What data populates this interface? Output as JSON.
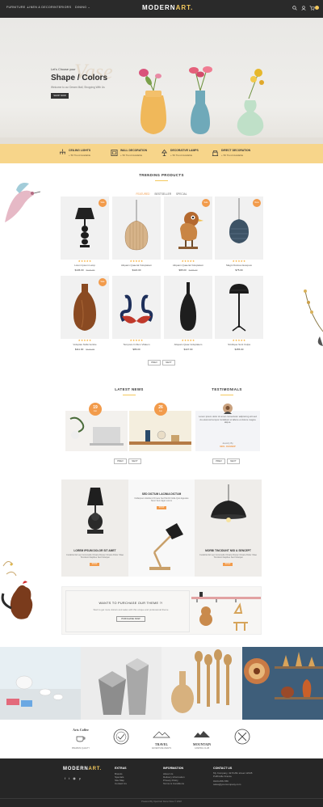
{
  "nav": {
    "menu": [
      "FURNITURE ⌄",
      "LINEN & DECOR",
      "INTERIORS",
      "DINING ⌄"
    ],
    "logo_main": "MODERN",
    "logo_accent": "ART."
  },
  "hero": {
    "script_heading": "Vase",
    "eyebrow": "Let's Choose your",
    "title": "Shape / Colors",
    "subtitle": "Welcome to our Dream Mall, Shopping With Us",
    "cta": "SHOP NOW"
  },
  "services": [
    {
      "title": "CEILING LIGHTS",
      "sub": "+ 50 Trend Available"
    },
    {
      "title": "WALL DECORATION",
      "sub": "+ 50 Trend Available"
    },
    {
      "title": "DECORATIVE LAMPS",
      "sub": "+ 50 Trend Available"
    },
    {
      "title": "DIRECT DECORATION",
      "sub": "+ 50 Trend Available"
    }
  ],
  "trending": {
    "title": "TRENDING PRODUCTS",
    "tabs": [
      "FEATURED",
      "BESTSELLER",
      "SPECIAL"
    ],
    "products": [
      {
        "name": "Lorem Ipsum Lamp",
        "price": "$136.00",
        "old": "$144.00",
        "badge": "Sale",
        "stars": "★★★★★"
      },
      {
        "name": "Aliquam Quaerat Voluptatem",
        "price": "$122.00",
        "old": "",
        "badge": "",
        "stars": "★★★★★"
      },
      {
        "name": "Aliquam Quaerat Voluptatem",
        "price": "$95.00",
        "old": "$106.00",
        "badge": "Sale",
        "stars": "★★★★★"
      },
      {
        "name": "Magni Dolores Eosquus",
        "price": "$75.00",
        "old": "",
        "badge": "New",
        "stars": "★★★★★"
      },
      {
        "name": "Voluptas Nulla Vertice",
        "price": "$111.00",
        "old": "$123.00",
        "badge": "Sale",
        "stars": "★★★★★"
      },
      {
        "name": "Tempora In Illum Vitatem",
        "price": "$86.00",
        "old": "",
        "badge": "",
        "stars": "★★★★★"
      },
      {
        "name": "Aliquam Quae Voluptatem",
        "price": "$147.00",
        "old": "",
        "badge": "",
        "stars": "★★★★★"
      },
      {
        "name": "Similique Sunt Culpa",
        "price": "$155.00",
        "old": "",
        "badge": "",
        "stars": "★★★★★"
      }
    ],
    "prev": "PREV",
    "next": "NEXT"
  },
  "news": {
    "title": "LATEST NEWS",
    "items": [
      {
        "day": "19",
        "mon": "Jun"
      },
      {
        "day": "26",
        "mon": "Jun"
      }
    ],
    "prev": "PREV",
    "next": "NEXT"
  },
  "testimonials": {
    "title": "TESTIMONIALS",
    "text": "Lorem ipsum dolor sit amet consectetur adipiscing elit sed do eiusmod tempor incididunt ut labore et dolore magna aliqua.",
    "designation": "Jewelry By",
    "name": "NIKL KEMBIP",
    "prev": "PREV",
    "next": "NEXT"
  },
  "banners": [
    {
      "title": "LOREM IPSUM DOLOR SIT AMET",
      "text": "Curabitur Et Leo Commodo Ornare Donec Ornare Dolor Vitae Tincidunt Dapibus Sed Volutpat",
      "cta": "SHOP"
    },
    {
      "title": "SED DICTUM LACINIA DICTUM",
      "text": "Nullaipsum Eleifend Ornare Sed Morbi Nulla Quis Egestas Nunc Sem Eget Lorem",
      "cta": "SHOP"
    },
    {
      "title": "MORBI TINCIDUNT NISI & SENCEPT",
      "text": "Curabitur Et Leo Commodo Ornare Donec Ornare Dolor Vitae Tincidunt Dapibus Sed Volutpat",
      "cta": "SHOP"
    }
  ],
  "purchase": {
    "title": "WANTS TO PURCHASE OUR THEME ?!",
    "text": "Start to get more visitors and sales with this unique and professional theme",
    "cta": "PURCHASE NOW"
  },
  "brands": [
    {
      "title": "Arts Coffee",
      "sub": "PREMIUM QUALITY"
    },
    {
      "title": "",
      "sub": ""
    },
    {
      "title": "TRAVEL",
      "sub": "ADVENTURE AWAITS"
    },
    {
      "title": "MOUNTAIN",
      "sub": "CAMPING CLUB"
    },
    {
      "title": "",
      "sub": ""
    }
  ],
  "footer": {
    "logo_main": "MODERN",
    "logo_accent": "ART.",
    "cols": [
      {
        "title": "EXTRAS",
        "links": [
          "Brands",
          "Specials",
          "Site Map",
          "Contact Us"
        ]
      },
      {
        "title": "INFORMATION",
        "links": [
          "About Us",
          "Delivery Information",
          "Privacy Policy",
          "Terms & Conditions"
        ]
      },
      {
        "title": "CONTACT US",
        "links": [
          "My Company, 42 Puffin street 12345 Puffinville France",
          "0123-456-789",
          "sales@yourcompany.com"
        ]
      }
    ],
    "copyright": "Powered By OpenCart Demo Store © 2018"
  },
  "colors": {
    "accent": "#f4c95d",
    "badge": "#f29b4b",
    "dark": "#262626"
  }
}
